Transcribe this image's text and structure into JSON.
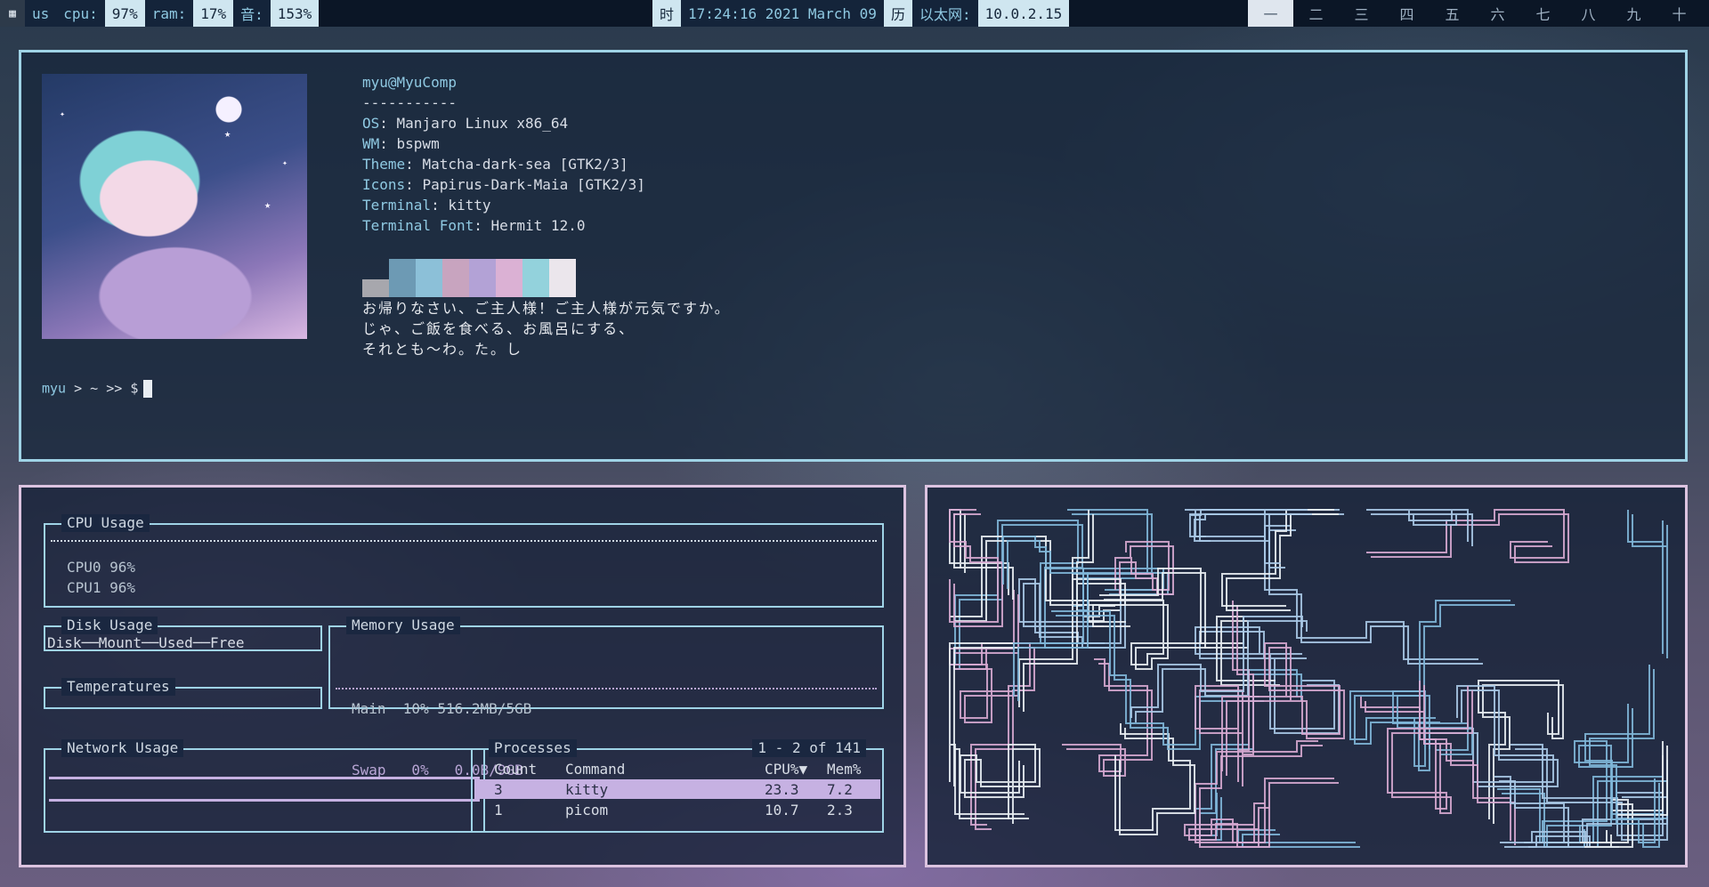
{
  "bar": {
    "logo": "▦",
    "layout": "us",
    "cpu_label": "cpu:",
    "cpu_value": "97%",
    "ram_label": "ram:",
    "ram_value": "17%",
    "vol_label": "音:",
    "vol_value": "153%",
    "time_label": "时",
    "datetime": "17:24:16 2021 March 09",
    "cal_label": "历",
    "net_label": "以太网:",
    "ip": "10.0.2.15",
    "workspaces": [
      "一",
      "二",
      "三",
      "四",
      "五",
      "六",
      "七",
      "八",
      "九",
      "十"
    ],
    "active_workspace": "一"
  },
  "terminal": {
    "userhost": "myu@MyuComp",
    "separator": "-----------",
    "info": [
      {
        "key": "OS",
        "value": "Manjaro Linux x86_64"
      },
      {
        "key": "WM",
        "value": "bspwm"
      },
      {
        "key": "Theme",
        "value": "Matcha-dark-sea [GTK2/3]"
      },
      {
        "key": "Icons",
        "value": "Papirus-Dark-Maia [GTK2/3]"
      },
      {
        "key": "Terminal",
        "value": "kitty"
      },
      {
        "key": "Terminal Font",
        "value": "Hermit 12.0"
      }
    ],
    "swatches": [
      "#a7a7ad",
      "#6d9ab4",
      "#8cc0d8",
      "#c8a4bf",
      "#b3a2d6",
      "#dbb1d4",
      "#93d2dc",
      "#ebe6ec"
    ],
    "message": [
      "お帰りなさい、ご主人様！ご主人様が元気ですか。",
      "じゃ、ご飯を食べる、お風呂にする、",
      "それとも～わ。た。し"
    ],
    "prompt_user": "myu",
    "prompt_rest": " > ~ >> $"
  },
  "gotop": {
    "cpu_title": "CPU Usage",
    "cpu_rows": [
      "CPU0  96%",
      "CPU1  96%"
    ],
    "disk_title": "Disk Usage",
    "disk_header": "Disk──Mount──Used──Free",
    "temp_title": "Temperatures",
    "mem_title": "Memory Usage",
    "mem_main": "Main  10% 516.2MB/5GB",
    "mem_swap": "Swap   0%   0.0B/9GB",
    "net_title": "Network Usage",
    "proc_title": "Processes",
    "proc_range": "1 - 2 of 141",
    "proc_headers": {
      "count": "Count",
      "command": "Command",
      "cpu": "CPU%▼",
      "mem": "Mem%"
    },
    "processes": [
      {
        "count": "3",
        "command": "kitty",
        "cpu": "23.3",
        "mem": "7.2"
      },
      {
        "count": "1",
        "command": "picom",
        "cpu": "10.7",
        "mem": "2.3"
      }
    ]
  },
  "colors": {
    "accent_cyan": "#9fd3e6",
    "accent_pink": "#dcc3e0",
    "selection": "#c6b1e2",
    "pipe_blue": "#7fb6d8",
    "pipe_pink": "#d6a8d0",
    "pipe_white": "#e8edf2"
  }
}
